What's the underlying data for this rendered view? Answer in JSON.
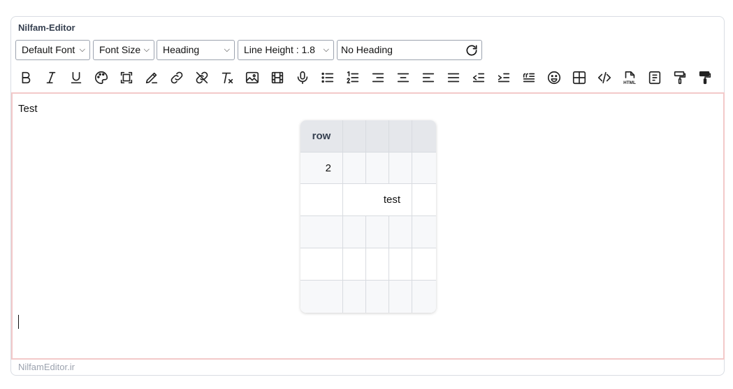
{
  "editor": {
    "title": "Nilfam-Editor",
    "footer": "NilfamEditor.ir"
  },
  "controls": {
    "font": "Default Font",
    "font_size": "Font Size",
    "heading": "Heading",
    "line_height": "Line Height : 1.8",
    "heading_input": "No Heading"
  },
  "toolbar": [
    "bold-icon",
    "italic-icon",
    "underline-icon",
    "palette-icon",
    "select-all-icon",
    "highlighter-icon",
    "link-icon",
    "unlink-icon",
    "clear-format-icon",
    "image-icon",
    "video-icon",
    "microphone-icon",
    "bullet-list-icon",
    "numbered-list-icon",
    "align-right-icon",
    "align-center-icon",
    "align-left-icon",
    "justify-icon",
    "outdent-icon",
    "indent-icon",
    "blockquote-icon",
    "emoji-icon",
    "table-icon",
    "code-icon",
    "html-icon",
    "paragraph-box-icon",
    "format-painter-icon",
    "paint-roller-icon"
  ],
  "content": {
    "text": "Test",
    "table": {
      "header": [
        "row",
        "",
        "",
        "",
        ""
      ],
      "rows": [
        [
          "2",
          "",
          "",
          "",
          ""
        ],
        [
          "",
          "test",
          "",
          "",
          ""
        ],
        [
          "",
          "",
          "",
          "",
          ""
        ],
        [
          "",
          "",
          "",
          "",
          ""
        ],
        [
          "",
          "",
          "",
          "",
          ""
        ]
      ]
    }
  }
}
